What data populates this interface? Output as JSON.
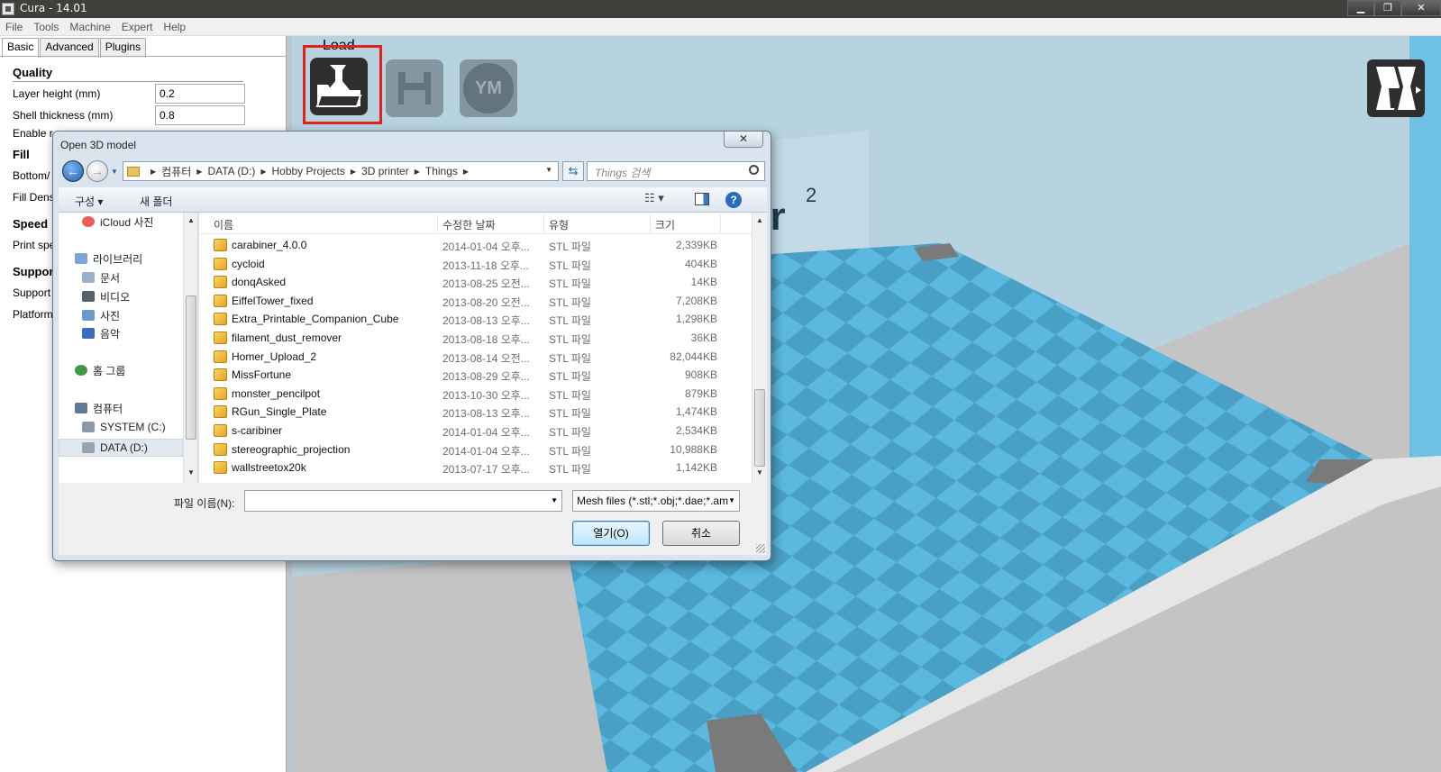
{
  "window": {
    "title": "Cura - 14.01",
    "minimize": "▁",
    "restore": "❐",
    "close": "✕"
  },
  "menu": [
    "File",
    "Tools",
    "Machine",
    "Expert",
    "Help"
  ],
  "tabs": [
    "Basic",
    "Advanced",
    "Plugins"
  ],
  "settings": {
    "quality_title": "Quality",
    "layer_height_label": "Layer height (mm)",
    "layer_height_value": "0.2",
    "shell_thickness_label": "Shell thickness (mm)",
    "shell_thickness_value": "0.8",
    "enable_label": "Enable r",
    "fill_title": "Fill",
    "bottom_label": "Bottom/",
    "fill_density_label": "Fill Dens",
    "speed_title": "Speed",
    "print_speed_label": "Print spe",
    "support_title": "Suppor",
    "support_label": "Support",
    "platform_label": "Platform"
  },
  "toolbar": {
    "load_label": "Load",
    "ym_label": "YM"
  },
  "brand": {
    "text": "er",
    "superscript": "2"
  },
  "dialog": {
    "title": "Open 3D model",
    "close": "✕",
    "breadcrumbs": [
      "컴퓨터",
      "DATA (D:)",
      "Hobby Projects",
      "3D printer",
      "Things"
    ],
    "search_placeholder": "Things 검색",
    "organize_label": "구성 ▾",
    "new_folder_label": "새 폴더",
    "view_label": "☷ ▾",
    "help_label": "?",
    "nav_items": [
      {
        "label": "iCloud 사진",
        "color": "#e95d5d"
      },
      {
        "label": "라이브러리",
        "color": "#7aa6d8"
      },
      {
        "label": "문서",
        "color": "#9ab0c8"
      },
      {
        "label": "비디오",
        "color": "#555f6e"
      },
      {
        "label": "사진",
        "color": "#6c9ac8"
      },
      {
        "label": "음악",
        "color": "#3a6cc0"
      },
      {
        "label": "홈 그룹",
        "color": "#3f9a4a"
      },
      {
        "label": "컴퓨터",
        "color": "#607a96"
      },
      {
        "label": "SYSTEM (C:)",
        "color": "#8a9aa8"
      },
      {
        "label": "DATA (D:)",
        "color": "#9aa4ae"
      }
    ],
    "columns": {
      "name": "이름",
      "date": "수정한 날짜",
      "type": "유형",
      "size": "크기"
    },
    "files": [
      {
        "name": "carabiner_4.0.0",
        "date": "2014-01-04 오후...",
        "type": "STL 파일",
        "size": "2,339KB"
      },
      {
        "name": "cycloid",
        "date": "2013-11-18 오후...",
        "type": "STL 파일",
        "size": "404KB"
      },
      {
        "name": "donqAsked",
        "date": "2013-08-25 오전...",
        "type": "STL 파일",
        "size": "14KB"
      },
      {
        "name": "EiffelTower_fixed",
        "date": "2013-08-20 오전...",
        "type": "STL 파일",
        "size": "7,208KB"
      },
      {
        "name": "Extra_Printable_Companion_Cube",
        "date": "2013-08-13 오후...",
        "type": "STL 파일",
        "size": "1,298KB"
      },
      {
        "name": "filament_dust_remover",
        "date": "2013-08-18 오후...",
        "type": "STL 파일",
        "size": "36KB"
      },
      {
        "name": "Homer_Upload_2",
        "date": "2013-08-14 오전...",
        "type": "STL 파일",
        "size": "82,044KB"
      },
      {
        "name": "MissFortune",
        "date": "2013-08-29 오후...",
        "type": "STL 파일",
        "size": "908KB"
      },
      {
        "name": "monster_pencilpot",
        "date": "2013-10-30 오후...",
        "type": "STL 파일",
        "size": "879KB"
      },
      {
        "name": "RGun_Single_Plate",
        "date": "2013-08-13 오후...",
        "type": "STL 파일",
        "size": "1,474KB"
      },
      {
        "name": "s-caribiner",
        "date": "2014-01-04 오후...",
        "type": "STL 파일",
        "size": "2,534KB"
      },
      {
        "name": "stereographic_projection",
        "date": "2014-01-04 오후...",
        "type": "STL 파일",
        "size": "10,988KB"
      },
      {
        "name": "wallstreetox20k",
        "date": "2013-07-17 오후...",
        "type": "STL 파일",
        "size": "1,142KB"
      }
    ],
    "filename_label": "파일 이름(N):",
    "filename_value": "",
    "filter_value": "Mesh files (*.stl;*.obj;*.dae;*.amf",
    "open_label": "열기(O)",
    "cancel_label": "취소"
  },
  "colors": {
    "accent_red": "#e2231a",
    "bed_blue": "#5bb8de",
    "bed_blue_dark": "#4a9fc4"
  }
}
